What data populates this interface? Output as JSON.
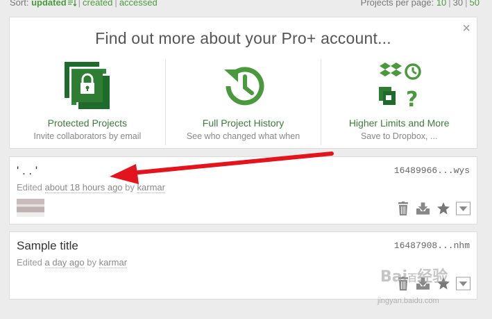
{
  "sort": {
    "label": "Sort:",
    "options": [
      "updated",
      "created",
      "accessed"
    ],
    "per_page_label": "Projects per page:",
    "per_page_options": [
      "10",
      "30",
      "50"
    ]
  },
  "promo": {
    "heading": "Find out more about your Pro+ account...",
    "close": "×",
    "features": [
      {
        "title": "Protected Projects",
        "desc": "Invite collaborators by email",
        "icon": "lock-docs-icon"
      },
      {
        "title": "Full Project History",
        "desc": "See who changed what when",
        "icon": "history-icon"
      },
      {
        "title": "Higher Limits and More",
        "desc": "Save to Dropbox, ...",
        "icon": "more-features-icon"
      }
    ]
  },
  "projects": [
    {
      "title": "' . . '",
      "id": "16489966...wys",
      "edited": "Edited",
      "when": "about 18 hours ago",
      "by": "by",
      "user": "karmar"
    },
    {
      "title": "Sample title",
      "id": "16487908...nhm",
      "edited": "Edited",
      "when": "a day ago",
      "by": "by",
      "user": "karmar"
    }
  ],
  "colors": {
    "accent": "#4a9a3d",
    "dark_green": "#1e6b2c",
    "arrow": "#e3141b"
  }
}
